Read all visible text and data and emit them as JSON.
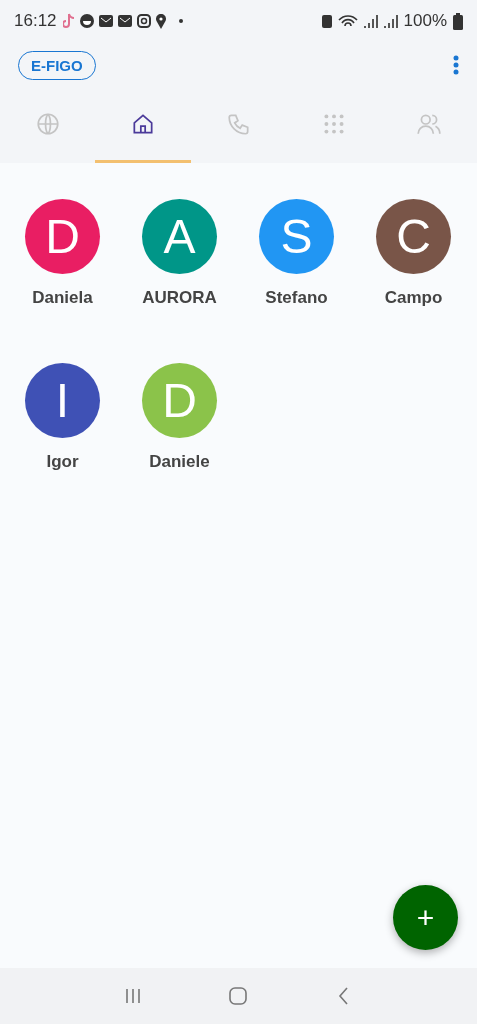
{
  "status_bar": {
    "time": "16:12",
    "battery": "100%"
  },
  "header": {
    "badge": "E-FIGO"
  },
  "tabs": [
    {
      "kind": "globe",
      "selected": false
    },
    {
      "kind": "home",
      "selected": true
    },
    {
      "kind": "phone",
      "selected": false
    },
    {
      "kind": "dialpad",
      "selected": false
    },
    {
      "kind": "people",
      "selected": false
    }
  ],
  "contacts": [
    {
      "initial": "D",
      "name": "Daniela",
      "color": "#e91e63"
    },
    {
      "initial": "A",
      "name": "AURORA",
      "color": "#009688"
    },
    {
      "initial": "S",
      "name": "Stefano",
      "color": "#2196f3"
    },
    {
      "initial": "C",
      "name": "Campo",
      "color": "#795548"
    },
    {
      "initial": "I",
      "name": "Igor",
      "color": "#3f51b5"
    },
    {
      "initial": "D",
      "name": "Daniele",
      "color": "#8bc34a"
    }
  ],
  "fab": {
    "label": "+"
  }
}
